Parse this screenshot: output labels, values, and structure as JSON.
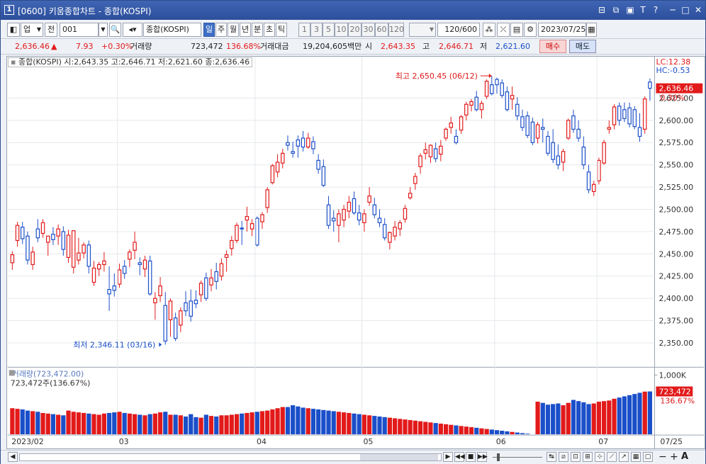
{
  "window": {
    "number": "1",
    "title": "[0600] 키움종합차트 - 종합(KOSPI)"
  },
  "toolbar": {
    "market_select": "업",
    "jeon_label": "전",
    "code_value": "001",
    "search_name": "종합(KOSPI)",
    "periods": [
      "일",
      "주",
      "월",
      "년",
      "분",
      "초",
      "틱"
    ],
    "selected_period": "일",
    "intervals": [
      "1",
      "3",
      "5",
      "10",
      "20",
      "30",
      "60",
      "120"
    ],
    "count_value": "120",
    "count_total": "/600",
    "date_value": "2023/07/25"
  },
  "quote": {
    "price": "2,636.46",
    "direction": "▲",
    "change": "7.93",
    "change_pct": "+0.30%",
    "volume_label": "거래량",
    "volume": "723,472",
    "volume_ratio": "136.68%",
    "amount_label": "거래대금",
    "amount": "19,204,605백만",
    "open_label": "시",
    "open": "2,643.35",
    "high_label": "고",
    "high": "2,646.71",
    "low_label": "저",
    "low": "2,621.60",
    "buy_label": "매수",
    "sell_label": "매도"
  },
  "price_panel": {
    "legend": "종합(KOSPI) 시:2,643.35 고:2,646.71 저:2,621.60 종:2,636.46",
    "lc": "LC:12.38",
    "hc": "HC:-0.53",
    "current_tag": "2,636.46",
    "current_pct": "0.30%",
    "high_note": "최고 2,650.45 (06/12)",
    "low_note": "최저 2,346.11 (03/16)"
  },
  "volume_panel": {
    "legend": "거래량(723,472.00)",
    "sub_legend": "723,472주(136.67%)",
    "scale_label": "1,000K",
    "current_tag": "723,472",
    "current_pct": "136.67%"
  },
  "x_axis": {
    "labels": [
      "2023/02",
      "03",
      "04",
      "05",
      "06",
      "07"
    ],
    "right_label": "07/25"
  },
  "colors": {
    "up": "#e21a1a",
    "down": "#1b4fc9",
    "title_bar": "#2d4f9c",
    "selected_button": "#3f6fc6"
  },
  "chart_data": {
    "type": "candlestick",
    "y_ticks": [
      2350,
      2375,
      2400,
      2425,
      2450,
      2475,
      2500,
      2525,
      2550,
      2575,
      2600,
      2625
    ],
    "y_tick_labels": [
      "2,350.00",
      "2,375.00",
      "2,400.00",
      "2,425.00",
      "2,450.00",
      "2,475.00",
      "2,500.00",
      "2,525.00",
      "2,550.00",
      "2,575.00",
      "2,600.00",
      "2,625.00"
    ],
    "ylim": [
      2325,
      2662
    ],
    "ohlc": [
      [
        2440,
        2453,
        2432,
        2449
      ],
      [
        2465,
        2486,
        2458,
        2482
      ],
      [
        2480,
        2486,
        2461,
        2467
      ],
      [
        2470,
        2475,
        2438,
        2443
      ],
      [
        2438,
        2458,
        2432,
        2452
      ],
      [
        2478,
        2489,
        2463,
        2468
      ],
      [
        2473,
        2489,
        2468,
        2485
      ],
      [
        2463,
        2470,
        2448,
        2470
      ],
      [
        2472,
        2480,
        2460,
        2466
      ],
      [
        2470,
        2483,
        2460,
        2478
      ],
      [
        2475,
        2481,
        2448,
        2455
      ],
      [
        2446,
        2477,
        2440,
        2471
      ],
      [
        2435,
        2476,
        2428,
        2476
      ],
      [
        2443,
        2468,
        2438,
        2451
      ],
      [
        2451,
        2463,
        2445,
        2460
      ],
      [
        2460,
        2465,
        2428,
        2436
      ],
      [
        2418,
        2442,
        2414,
        2434
      ],
      [
        2433,
        2441,
        2425,
        2438
      ],
      [
        2438,
        2452,
        2430,
        2442
      ],
      [
        2410,
        2436,
        2386,
        2405
      ],
      [
        2414,
        2428,
        2402,
        2409
      ],
      [
        2416,
        2439,
        2412,
        2432
      ],
      [
        2436,
        2443,
        2422,
        2428
      ],
      [
        2444,
        2455,
        2435,
        2452
      ],
      [
        2454,
        2475,
        2444,
        2463
      ],
      [
        2440,
        2446,
        2426,
        2438
      ],
      [
        2433,
        2448,
        2424,
        2443
      ],
      [
        2442,
        2448,
        2403,
        2405
      ],
      [
        2395,
        2407,
        2376,
        2400
      ],
      [
        2403,
        2424,
        2396,
        2414
      ],
      [
        2392,
        2407,
        2348,
        2352
      ],
      [
        2376,
        2400,
        2357,
        2397
      ],
      [
        2378,
        2384,
        2352,
        2355
      ],
      [
        2370,
        2390,
        2362,
        2386
      ],
      [
        2395,
        2408,
        2380,
        2386
      ],
      [
        2397,
        2410,
        2374,
        2380
      ],
      [
        2398,
        2409,
        2389,
        2394
      ],
      [
        2404,
        2420,
        2396,
        2417
      ],
      [
        2423,
        2429,
        2397,
        2400
      ],
      [
        2415,
        2433,
        2408,
        2423
      ],
      [
        2430,
        2440,
        2410,
        2419
      ],
      [
        2425,
        2445,
        2420,
        2439
      ],
      [
        2446,
        2454,
        2430,
        2449
      ],
      [
        2456,
        2470,
        2448,
        2465
      ],
      [
        2465,
        2485,
        2462,
        2482
      ],
      [
        2479,
        2487,
        2460,
        2478
      ],
      [
        2488,
        2503,
        2475,
        2492
      ],
      [
        2478,
        2489,
        2470,
        2484
      ],
      [
        2490,
        2492,
        2458,
        2460
      ],
      [
        2486,
        2497,
        2478,
        2494
      ],
      [
        2502,
        2525,
        2496,
        2522
      ],
      [
        2530,
        2551,
        2528,
        2549
      ],
      [
        2542,
        2562,
        2536,
        2553
      ],
      [
        2552,
        2568,
        2546,
        2563
      ],
      [
        2575,
        2583,
        2566,
        2572
      ],
      [
        2565,
        2576,
        2558,
        2563
      ],
      [
        2578,
        2583,
        2558,
        2571
      ],
      [
        2580,
        2588,
        2565,
        2570
      ],
      [
        2570,
        2586,
        2568,
        2580
      ],
      [
        2576,
        2582,
        2562,
        2568
      ],
      [
        2555,
        2562,
        2540,
        2545
      ],
      [
        2548,
        2556,
        2525,
        2527
      ],
      [
        2505,
        2515,
        2478,
        2482
      ],
      [
        2490,
        2499,
        2475,
        2487
      ],
      [
        2482,
        2500,
        2463,
        2495
      ],
      [
        2488,
        2505,
        2480,
        2500
      ],
      [
        2498,
        2515,
        2490,
        2508
      ],
      [
        2512,
        2520,
        2494,
        2496
      ],
      [
        2496,
        2505,
        2482,
        2488
      ],
      [
        2485,
        2500,
        2475,
        2495
      ],
      [
        2508,
        2525,
        2504,
        2515
      ],
      [
        2505,
        2513,
        2490,
        2494
      ],
      [
        2490,
        2500,
        2480,
        2485
      ],
      [
        2483,
        2490,
        2465,
        2468
      ],
      [
        2463,
        2475,
        2455,
        2474
      ],
      [
        2470,
        2487,
        2465,
        2480
      ],
      [
        2478,
        2488,
        2470,
        2485
      ],
      [
        2489,
        2505,
        2485,
        2501
      ],
      [
        2513,
        2525,
        2511,
        2518
      ],
      [
        2529,
        2541,
        2522,
        2537
      ],
      [
        2548,
        2563,
        2540,
        2560
      ],
      [
        2563,
        2575,
        2556,
        2567
      ],
      [
        2559,
        2573,
        2552,
        2572
      ],
      [
        2568,
        2575,
        2553,
        2557
      ],
      [
        2562,
        2578,
        2554,
        2571
      ],
      [
        2580,
        2592,
        2577,
        2590
      ],
      [
        2592,
        2604,
        2585,
        2597
      ],
      [
        2582,
        2590,
        2573,
        2575
      ],
      [
        2589,
        2606,
        2585,
        2604
      ],
      [
        2606,
        2621,
        2600,
        2618
      ],
      [
        2617,
        2624,
        2610,
        2621
      ],
      [
        2626,
        2633,
        2610,
        2612
      ],
      [
        2612,
        2622,
        2602,
        2619
      ],
      [
        2627,
        2646,
        2624,
        2644
      ],
      [
        2640,
        2650,
        2628,
        2630
      ],
      [
        2646,
        2648,
        2630,
        2640
      ],
      [
        2642,
        2646,
        2625,
        2628
      ],
      [
        2632,
        2638,
        2610,
        2612
      ],
      [
        2624,
        2638,
        2612,
        2628
      ],
      [
        2618,
        2626,
        2600,
        2605
      ],
      [
        2604,
        2612,
        2588,
        2592
      ],
      [
        2605,
        2610,
        2580,
        2583
      ],
      [
        2598,
        2603,
        2572,
        2575
      ],
      [
        2580,
        2598,
        2574,
        2595
      ],
      [
        2592,
        2602,
        2575,
        2590
      ],
      [
        2582,
        2588,
        2560,
        2563
      ],
      [
        2575,
        2590,
        2552,
        2556
      ],
      [
        2560,
        2573,
        2545,
        2550
      ],
      [
        2553,
        2568,
        2543,
        2565
      ],
      [
        2580,
        2602,
        2578,
        2600
      ],
      [
        2605,
        2612,
        2586,
        2590
      ],
      [
        2590,
        2600,
        2576,
        2580
      ],
      [
        2570,
        2582,
        2545,
        2550
      ],
      [
        2542,
        2550,
        2518,
        2522
      ],
      [
        2520,
        2532,
        2515,
        2528
      ],
      [
        2532,
        2558,
        2528,
        2555
      ],
      [
        2552,
        2578,
        2550,
        2575
      ],
      [
        2590,
        2600,
        2585,
        2592
      ],
      [
        2595,
        2618,
        2590,
        2615
      ],
      [
        2616,
        2620,
        2594,
        2600
      ],
      [
        2612,
        2620,
        2598,
        2602
      ],
      [
        2614,
        2620,
        2592,
        2596
      ],
      [
        2612,
        2616,
        2590,
        2593
      ],
      [
        2592,
        2608,
        2576,
        2582
      ],
      [
        2590,
        2627,
        2585,
        2624
      ],
      [
        2643,
        2647,
        2622,
        2636
      ]
    ],
    "volume": [
      390,
      370,
      340,
      300,
      330,
      310,
      350,
      340,
      290,
      300,
      310,
      290,
      300,
      320,
      350,
      310,
      290,
      290,
      300,
      310,
      290,
      310,
      340,
      370,
      360,
      330,
      320,
      330,
      300,
      320,
      370,
      330,
      350,
      360,
      400,
      390,
      360,
      350,
      340,
      330,
      380,
      400,
      420,
      450,
      470,
      460,
      440,
      450,
      490,
      510,
      470,
      500,
      480,
      460,
      440,
      520,
      530,
      510,
      480,
      470,
      520,
      450,
      440,
      480,
      420,
      460,
      380,
      360,
      350,
      380,
      390,
      410,
      380,
      360,
      350,
      330,
      340,
      350,
      340,
      330,
      370,
      420,
      430,
      440,
      430,
      400,
      380,
      360,
      350,
      400,
      410,
      370,
      340,
      340,
      350,
      360,
      380,
      390,
      400,
      370,
      350,
      340,
      330,
      320,
      340,
      310,
      300,
      310,
      320,
      330,
      340,
      350,
      370,
      380,
      360,
      340,
      330,
      310,
      300,
      320,
      330,
      340,
      370,
      410,
      430,
      420,
      410,
      400,
      390,
      380,
      400,
      420,
      440,
      450,
      430,
      420,
      410,
      400,
      420,
      450,
      470,
      460,
      440,
      430,
      410,
      400,
      390,
      380,
      410,
      420,
      430,
      420,
      400,
      390,
      380,
      370,
      360,
      350,
      340,
      330,
      360,
      410,
      440,
      460,
      480,
      490,
      470,
      460,
      450,
      440,
      430,
      420,
      400,
      390,
      380,
      360,
      350,
      340,
      330,
      320,
      400,
      380,
      370,
      360,
      350,
      340,
      330,
      350,
      360,
      370,
      380,
      360,
      350,
      340,
      330,
      320,
      340,
      350,
      370,
      380,
      330,
      330,
      320,
      300,
      340,
      290,
      280,
      330,
      310,
      300,
      320,
      320,
      330,
      340,
      350,
      360,
      370,
      380,
      390,
      400,
      420,
      440,
      460,
      460,
      490,
      470,
      450,
      440,
      430,
      420,
      410,
      400,
      390,
      380,
      370,
      360,
      350,
      340,
      330,
      320,
      310,
      300,
      290,
      280,
      270,
      260,
      250,
      240,
      230,
      220,
      210,
      200,
      190,
      180,
      170,
      160,
      150,
      140,
      130,
      120,
      110,
      100,
      90,
      80,
      70,
      60,
      50,
      40,
      30,
      20,
      10,
      0,
      550,
      530,
      500,
      510,
      520,
      490,
      530,
      580,
      560,
      540,
      510,
      520,
      550,
      560,
      570,
      600,
      620,
      640,
      660,
      680,
      700,
      720,
      723
    ]
  }
}
